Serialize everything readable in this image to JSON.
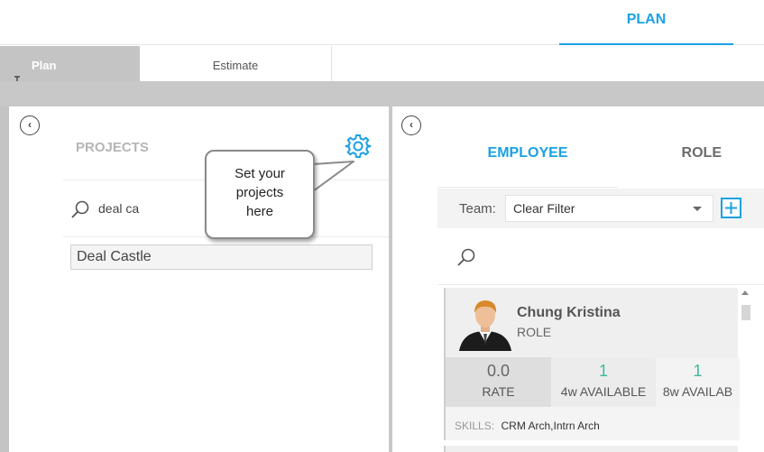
{
  "header": {
    "plan_tab": "PLAN"
  },
  "subtabs": {
    "plan": "Plan",
    "estimate": "Estimate"
  },
  "left_panel": {
    "title": "PROJECTS",
    "search_value": "deal ca",
    "result": "Deal Castle"
  },
  "callout": {
    "line1": "Set your",
    "line2": "projects",
    "line3": "here"
  },
  "right_panel": {
    "tab_employee": "EMPLOYEE",
    "tab_role": "ROLE",
    "team_label": "Team:",
    "team_value": "Clear Filter",
    "employee": {
      "name": "Chung Kristina",
      "role": "ROLE",
      "rate_value": "0.0",
      "rate_label": "RATE",
      "avail4_value": "1",
      "avail4_label": "4w AVAILABLE",
      "avail8_value": "1",
      "avail8_label": "8w AVAILAB",
      "skills_label": "SKILLS:",
      "skills_value": "CRM Arch,Intrn Arch"
    }
  },
  "colors": {
    "accent": "#1ba1e2",
    "available": "#3cb99a",
    "panel_gray": "#c8c8c8"
  },
  "icons": [
    "collapse-left-icon",
    "gear-icon",
    "search-icon",
    "chevron-down-icon",
    "plus-icon",
    "text-cursor-icon"
  ]
}
